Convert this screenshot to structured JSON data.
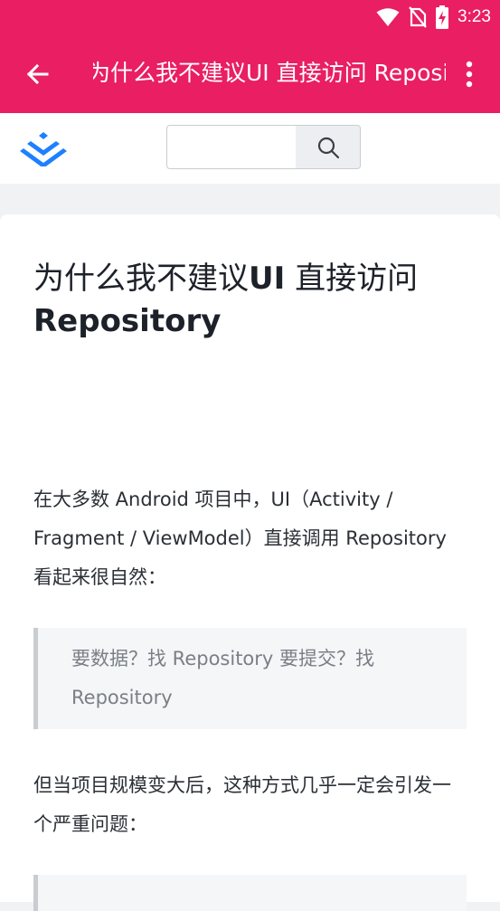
{
  "status_bar": {
    "time": "3:23",
    "icons": [
      "wifi-icon",
      "no-sim-icon",
      "battery-charging-icon"
    ]
  },
  "app_bar": {
    "title": "为什么我不建议UI 直接访问 Repository",
    "back_icon": "arrow-back-icon",
    "more_icon": "more-vert-icon",
    "color": "#e91e63"
  },
  "site_header": {
    "logo_icon": "juejin-logo-icon",
    "search_placeholder": "",
    "search_icon": "search-icon",
    "accent": "#1e80ff"
  },
  "article": {
    "title_plain": "为什么我不建议",
    "title_bold_1": "UI",
    "title_plain_2": " 直接访问",
    "title_bold_2": "Repository",
    "intro": "在大多数 Android 项目中，UI（Activity / Fragment / ViewModel）直接调用 Repository 看起来很自然：",
    "quote": "要数据？找 Repository 要提交？找 Repository",
    "para2": "但当项目规模变大后，这种方式几乎一定会引发一个严重问题："
  }
}
